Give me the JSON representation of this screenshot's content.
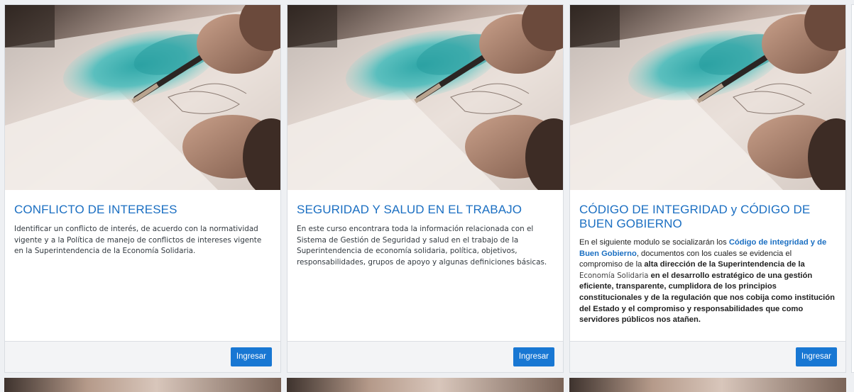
{
  "courses": [
    {
      "title": "CONFLICTO DE INTERESES",
      "description": "Identificar un conflicto de interés, de acuerdo con la normatividad vigente y a la Política de manejo de conflictos de intereses vigente en la Superintendencia de la Economía Solidaria.",
      "button_label": "Ingresar",
      "image": "painting-watercolor-photo"
    },
    {
      "title": "SEGURIDAD Y SALUD EN EL TRABAJO",
      "description": "En este curso encontrara toda la información relacionada con el Sistema de Gestión de Seguridad y salud en el trabajo de la Superintendencia de economía solidaria, política, objetivos, responsabilidades, grupos de apoyo y algunas definiciones básicas.",
      "button_label": "Ingresar",
      "image": "painting-watercolor-photo"
    },
    {
      "title": "CÓDIGO DE INTEGRIDAD y CÓDIGO DE BUEN GOBIERNO",
      "description_parts": {
        "p1": "En el siguiente modulo  se socializarán los ",
        "link": "Código de integridad y de Buen Gobierno",
        "p2": ", documentos con los cuales se evidencia el compromiso de la ",
        "b1": "alta dirección de la Superintendencia de la",
        "p3": "Economía Solidaria",
        "b2": " en el desarrollo estratégico de una gestión eficiente, transparente, cumplidora de los principios constitucionales y de la regulación que nos cobija como institución del Estado y el compromiso y responsabilidades que como servidores públicos nos atañen."
      },
      "button_label": "Ingresar",
      "image": "painting-watercolor-photo"
    }
  ],
  "colors": {
    "title": "#1b6fc2",
    "button": "#1877d3",
    "background": "#eef0f3"
  }
}
